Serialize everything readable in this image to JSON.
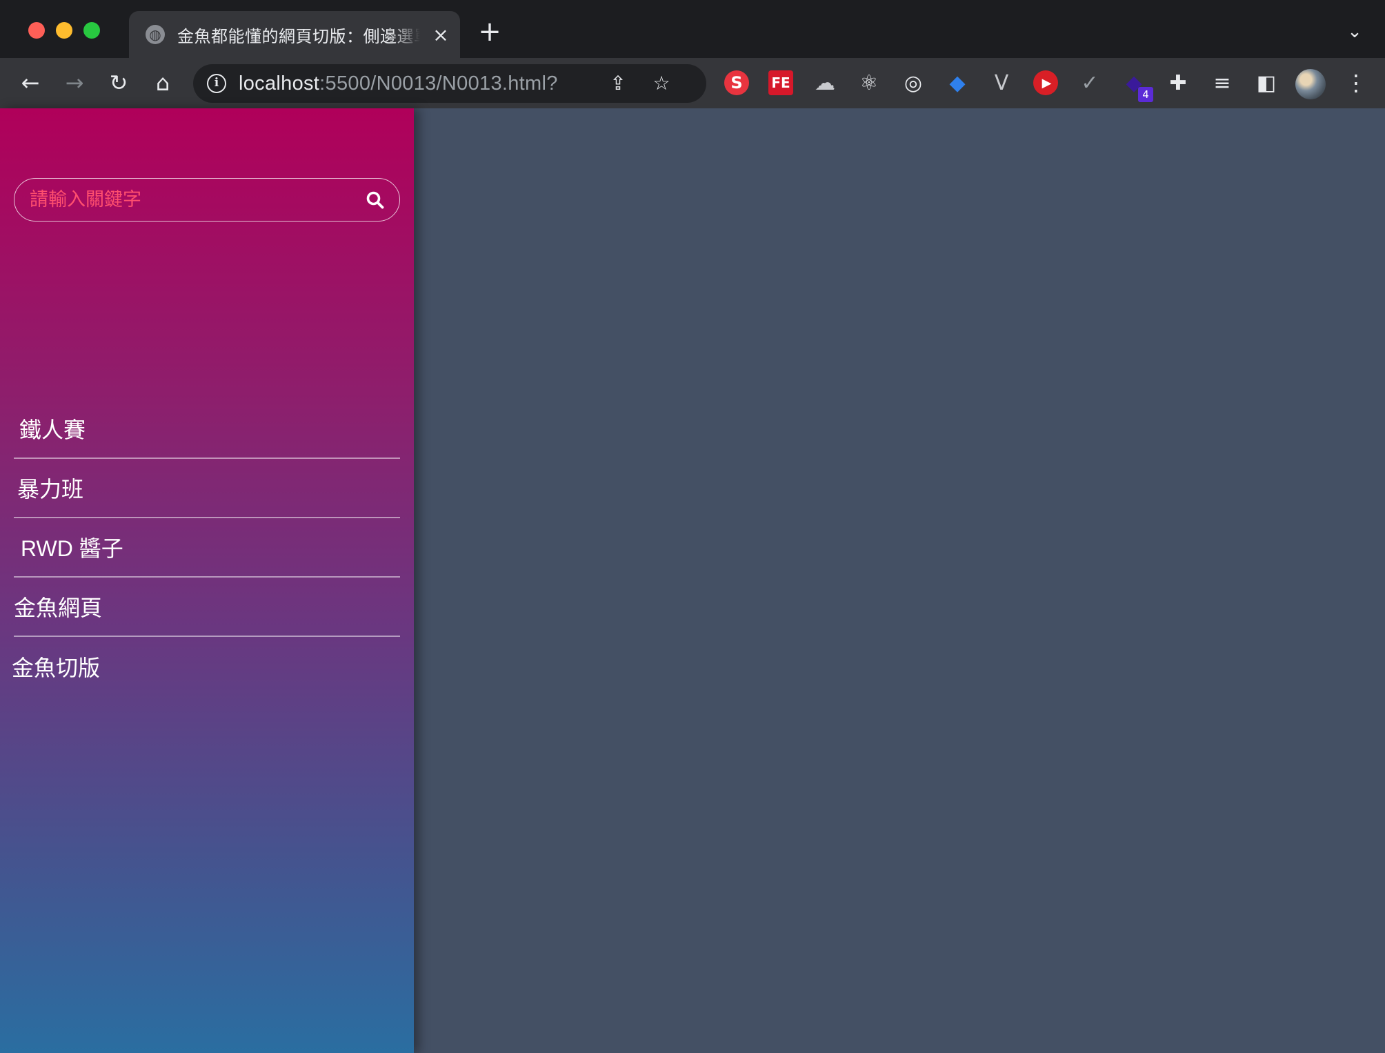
{
  "browser": {
    "tab": {
      "title": "金魚都能懂的網頁切版：側邊選單",
      "favicon": "globe-icon",
      "close": "×"
    },
    "new_tab": "+",
    "tab_list": "⌄",
    "nav": {
      "back": "←",
      "forward": "→",
      "reload": "↻",
      "home": "⌂"
    },
    "address": {
      "host": "localhost",
      "rest": ":5500/N0013/N0013.html?",
      "info": "i"
    },
    "omnibox_icons": {
      "share": "⇪",
      "bookmark": "☆"
    },
    "extensions": [
      {
        "name": "s-extension-icon",
        "glyph": "S",
        "color": "#e8343f"
      },
      {
        "name": "fe-extension-icon",
        "glyph": "FE",
        "color": "#d6182a"
      },
      {
        "name": "cloud-extension-icon",
        "glyph": "☁",
        "color": "#c8cace"
      },
      {
        "name": "react-extension-icon",
        "glyph": "⚛",
        "color": "#e8eaed"
      },
      {
        "name": "target-extension-icon",
        "glyph": "◎",
        "color": "#e8eaed"
      },
      {
        "name": "gem-extension-icon",
        "glyph": "◆",
        "color": "#2f80ed"
      },
      {
        "name": "vue-extension-icon",
        "glyph": "V",
        "color": "#c8cace"
      },
      {
        "name": "play-extension-icon",
        "glyph": "▶",
        "color": "#ffffff"
      },
      {
        "name": "check-extension-icon",
        "glyph": "✓",
        "color": "#9aa0a6"
      },
      {
        "name": "cube-extension-icon",
        "glyph": "◆",
        "color": "#3a1a9a",
        "badge": "4"
      },
      {
        "name": "puzzle-extension-icon",
        "glyph": "✚",
        "color": "#e8eaed"
      },
      {
        "name": "reading-list-icon",
        "glyph": "≡",
        "color": "#e8eaed"
      },
      {
        "name": "side-panel-icon",
        "glyph": "◧",
        "color": "#e8eaed"
      }
    ],
    "menu": "⋮"
  },
  "sidebar": {
    "search": {
      "placeholder": "請輸入關鍵字",
      "value": ""
    },
    "items": [
      {
        "label": "鐵人賽"
      },
      {
        "label": "暴力班"
      },
      {
        "label": "RWD 醬子"
      },
      {
        "label": "金魚網頁"
      },
      {
        "label": "金魚切版"
      }
    ]
  },
  "colors": {
    "sidebar_top": "#b0005a",
    "sidebar_bottom": "#2a6ea1",
    "content_bg": "#445064",
    "placeholder": "#ff4f6e"
  }
}
